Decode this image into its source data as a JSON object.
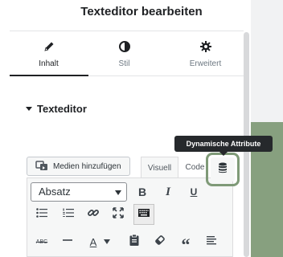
{
  "panel": {
    "title": "Texteditor bearbeiten"
  },
  "tabs": [
    {
      "label": "Inhalt",
      "icon": "pencil-icon",
      "active": true
    },
    {
      "label": "Stil",
      "icon": "half-circle-icon",
      "active": false
    },
    {
      "label": "Erweitert",
      "icon": "gear-icon",
      "active": false
    }
  ],
  "section": {
    "label": "Texteditor"
  },
  "tooltip": {
    "text": "Dynamische Attribute"
  },
  "media_button": {
    "label": "Medien hinzufügen"
  },
  "editor_tabs": {
    "visual": "Visuell",
    "code": "Code"
  },
  "dynamic_button": {
    "icon": "database-icon"
  },
  "format_select": {
    "value": "Absatz"
  },
  "toolbar": {
    "bold": "B",
    "italic": "I",
    "underline": "U",
    "strikethrough": "ABC",
    "text_color": "A",
    "quote": "“"
  },
  "colors": {
    "accent_highlight": "#7f9a78",
    "tooltip_bg": "#26292c",
    "side_green": "#87a07f"
  }
}
